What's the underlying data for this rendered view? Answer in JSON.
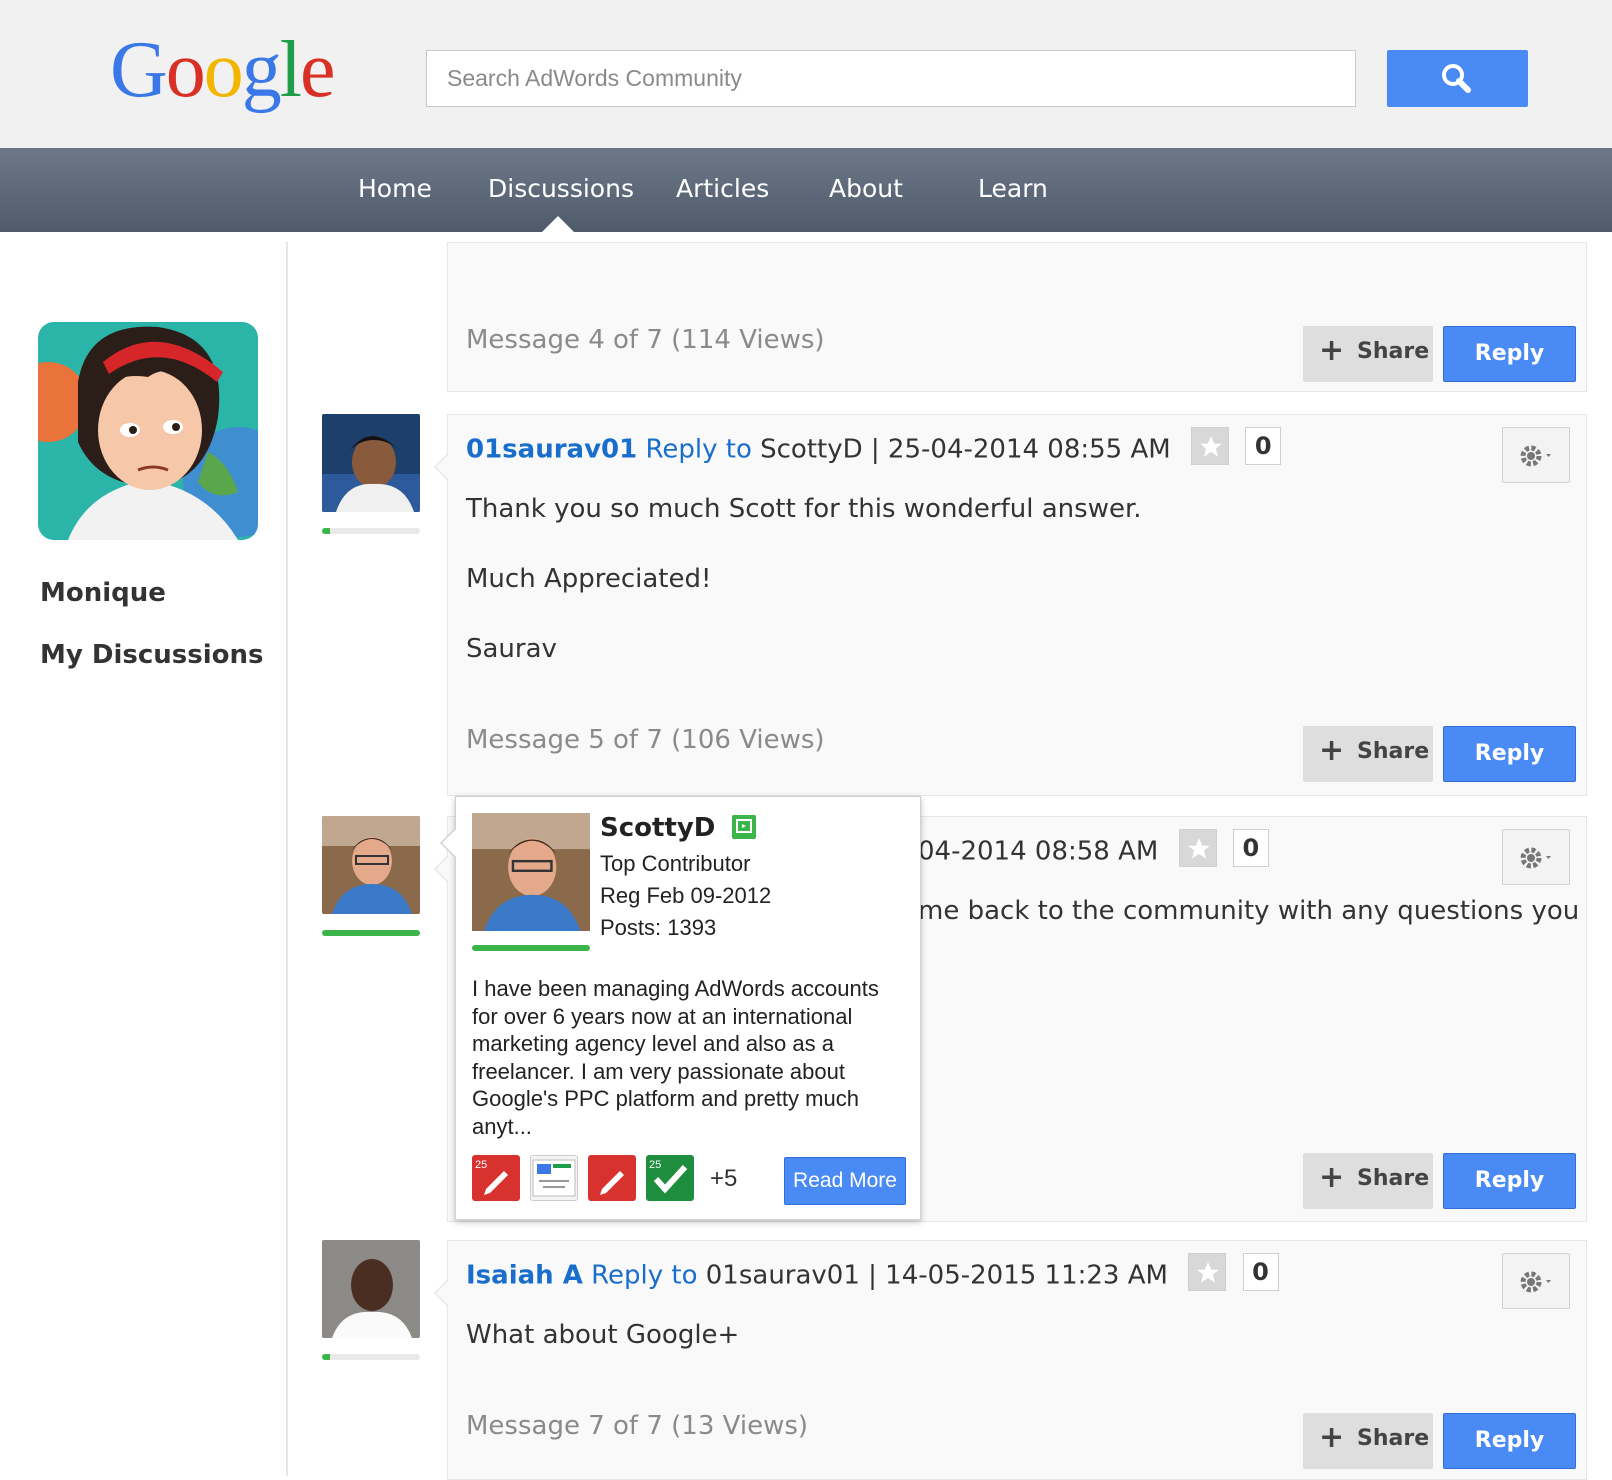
{
  "header": {
    "logo": [
      "G",
      "o",
      "o",
      "g",
      "l",
      "e"
    ],
    "logo_colors": [
      "#3b78e7",
      "#d93025",
      "#f2b600",
      "#3b78e7",
      "#1e9e4a",
      "#d93025"
    ],
    "search_placeholder": "Search AdWords Community",
    "search_icon": "search-icon"
  },
  "nav": {
    "items": [
      "Home",
      "Discussions",
      "Articles",
      "About",
      "Learn"
    ],
    "active": "Discussions"
  },
  "sidebar": {
    "user_name": "Monique",
    "link": "My Discussions"
  },
  "messages": [
    {
      "meta": "Message 4 of 7 (114 Views)",
      "share_label": "Share",
      "reply_label": "Reply"
    },
    {
      "author": "01saurav01",
      "reply_to_label": "Reply to",
      "reply_to_user": "ScottyD",
      "date": "| 25-04-2014 08:55 AM",
      "kudos": "0",
      "reputation": 0.08,
      "body": [
        "Thank you so much Scott for this wonderful answer.",
        "Much Appreciated!",
        "Saurav"
      ],
      "meta": "Message 5 of 7 (106 Views)",
      "share_label": "Share",
      "reply_label": "Reply"
    },
    {
      "date": "04-2014 08:58 AM",
      "kudos": "0",
      "reputation": 1.0,
      "body_fragment": "me back to the community with any questions you",
      "share_label": "Share",
      "reply_label": "Reply"
    },
    {
      "author": "Isaiah A",
      "reply_to_label": "Reply to",
      "reply_to_user": "01saurav01",
      "date": "| 14-05-2015 11:23 AM",
      "kudos": "0",
      "reputation": 0.08,
      "body": "What about Google+",
      "meta": "Message 7 of 7 (13 Views)",
      "share_label": "Share",
      "reply_label": "Reply"
    }
  ],
  "profile_card": {
    "name": "ScottyD",
    "rank": "Top Contributor",
    "registered": "Reg Feb 09-2012",
    "posts": "Posts: 1393",
    "reputation": 1.0,
    "bio": "I have been managing AdWords accounts for over 6 years now at an international marketing agency level and also as a freelancer. I am very passionate about Google's PPC platform and pretty much anyt...",
    "badges": [
      "pencil-badge-25",
      "certificate-badge",
      "pencil-badge",
      "checkmark-badge-25"
    ],
    "badge_number": "25",
    "more_badges": "+5",
    "read_more": "Read More"
  }
}
